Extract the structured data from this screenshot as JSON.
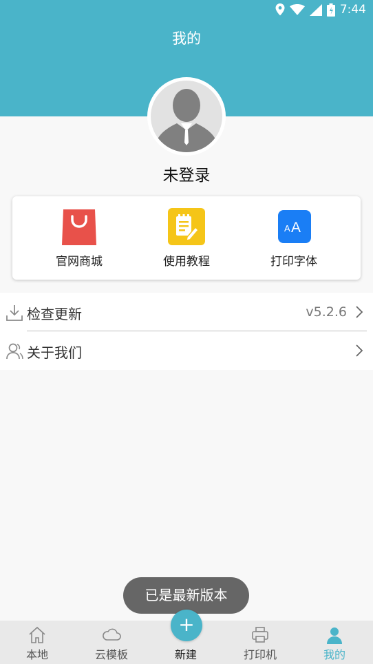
{
  "status_bar": {
    "time": "7:44"
  },
  "header": {
    "title": "我的"
  },
  "profile": {
    "status": "未登录"
  },
  "shortcuts": [
    {
      "label": "官网商城",
      "icon": "shopping-bag-icon",
      "color": "#e8514a"
    },
    {
      "label": "使用教程",
      "icon": "notepad-pen-icon",
      "color": "#f5c518"
    },
    {
      "label": "打印字体",
      "icon": "font-size-icon",
      "color": "#1a7ef5"
    }
  ],
  "menu": [
    {
      "label": "检查更新",
      "value": "v5.2.6",
      "icon": "download-icon"
    },
    {
      "label": "关于我们",
      "value": "",
      "icon": "user-icon"
    }
  ],
  "toast": {
    "message": "已是最新版本"
  },
  "tabbar": {
    "tabs": [
      {
        "label": "本地",
        "icon": "home-icon"
      },
      {
        "label": "云模板",
        "icon": "cloud-icon"
      },
      {
        "label": "新建",
        "icon": "plus-icon"
      },
      {
        "label": "打印机",
        "icon": "printer-icon"
      },
      {
        "label": "我的",
        "icon": "profile-icon"
      }
    ],
    "active_index": 4,
    "fab_symbol": "+",
    "accent_color": "#4ab4c9"
  }
}
